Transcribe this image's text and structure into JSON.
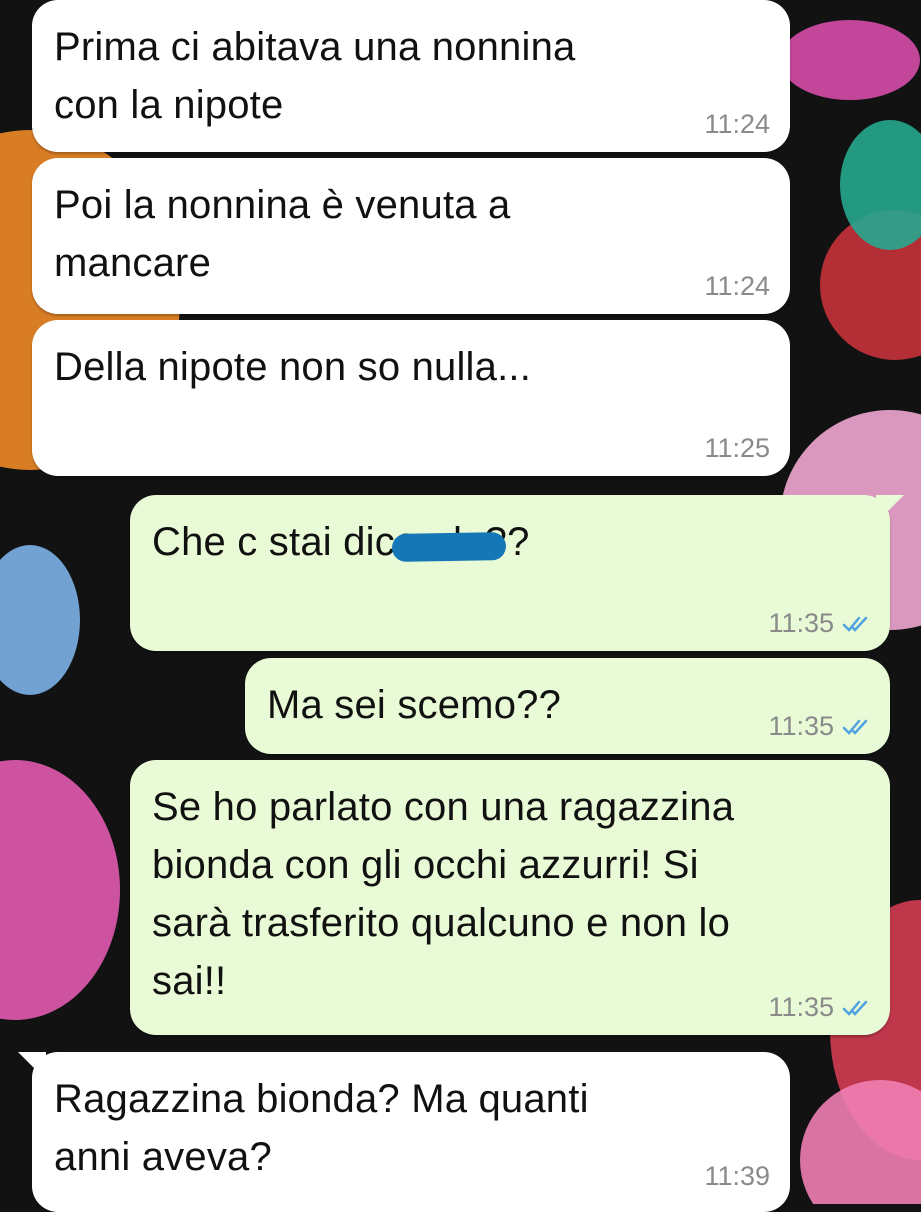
{
  "messages": [
    {
      "direction": "incoming",
      "text": "Prima ci abitava una nonnina\ncon la nipote",
      "time": "11:24"
    },
    {
      "direction": "incoming",
      "text": "Poi la nonnina è venuta a\nmancare",
      "time": "11:24"
    },
    {
      "direction": "incoming",
      "text": "Della nipote non so nulla...",
      "time": "11:25"
    },
    {
      "direction": "outgoing",
      "text": "Che c⁠⁠⁠⁠⁠⁠⁠⁠⁠⁠ stai dicendo??",
      "time": "11:35",
      "status_icon": "double-check-icon"
    },
    {
      "direction": "outgoing",
      "text": "Ma sei scemo??",
      "time": "11:35",
      "status_icon": "double-check-icon"
    },
    {
      "direction": "outgoing",
      "text": "Se ho parlato con una ragazzina\nbionda con gli occhi azzurri! Si\nsarà trasferito qualcuno e non lo\nsai!!",
      "time": "11:35",
      "status_icon": "double-check-icon"
    },
    {
      "direction": "incoming",
      "text": "Ragazzina bionda? Ma quanti\nanni aveva?",
      "time": "11:39"
    }
  ],
  "colors": {
    "incoming_bubble": "#ffffff",
    "outgoing_bubble": "#e9fbd6",
    "timestamp": "#8a8a8a",
    "read_ticks": "#4fa3e0",
    "censor_mark": "#1677b7"
  }
}
